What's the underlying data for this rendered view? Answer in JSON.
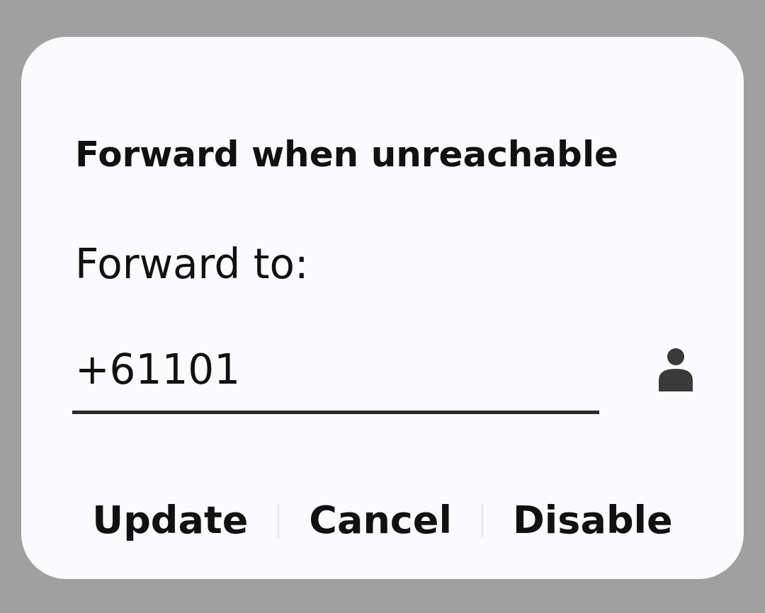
{
  "dialog": {
    "title": "Forward when unreachable",
    "label": "Forward to:",
    "field": {
      "value": "+61101"
    },
    "buttons": [
      "Update",
      "Cancel",
      "Disable"
    ]
  }
}
